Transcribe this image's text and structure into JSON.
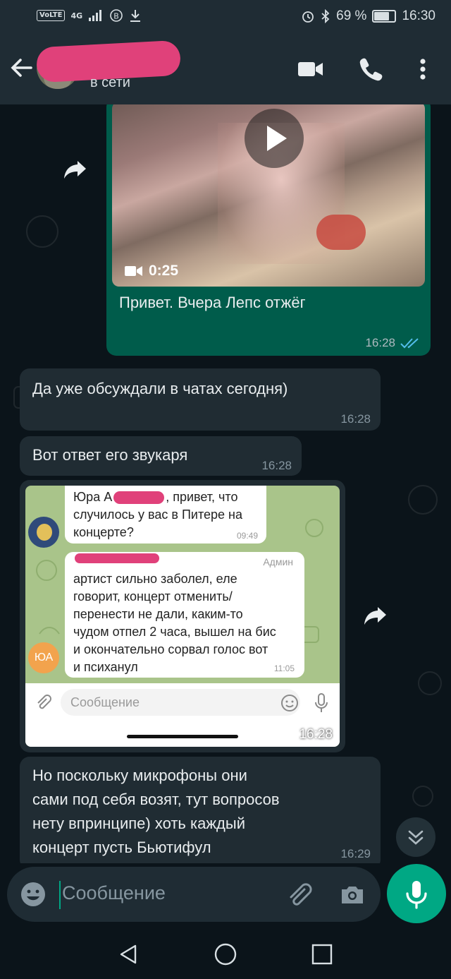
{
  "statusbar": {
    "volte": "VoLTE",
    "network": "4G",
    "battery": "69 %",
    "battery_level": 0.69,
    "time": "16:30"
  },
  "header": {
    "contact_status": "в сети"
  },
  "messages": {
    "video": {
      "duration": "0:25",
      "caption": "Привет. Вчера Лепс отжёг",
      "time": "16:28"
    },
    "m1": {
      "text": "Да уже обсуждали в чатах сегодня)",
      "time": "16:28"
    },
    "m2": {
      "text": "Вот ответ его звукаря",
      "time": "16:28"
    },
    "screenshot": {
      "q_line1": "Юра А",
      "q_line1b": ", привет, что",
      "q_line2": "случилось у вас в Питере на",
      "q_line3": "концерте?",
      "q_time": "09:49",
      "a_role": "Админ",
      "a_lines": [
        "артист сильно заболел, еле",
        "говорит, концерт отменить/",
        "перенести не дали, каким-то",
        "чудом отпел 2 часа, вышел на бис",
        "и окончательно сорвал голос вот",
        "и психанул"
      ],
      "a_time": "11:05",
      "a_avatar": "ЮА",
      "input_placeholder": "Сообщение",
      "time": "16:28"
    },
    "m3": {
      "lines": [
        "Но поскольку микрофоны они",
        "сами под себя возят, тут вопросов",
        "нету впринципе) хоть каждый",
        "концерт пусть Бьютифул"
      ],
      "time": "16:29"
    }
  },
  "composer": {
    "placeholder": "Сообщение"
  },
  "colors": {
    "accent": "#00a884",
    "outgoing_bubble": "#005c4b",
    "incoming_bubble": "#202c33",
    "read_ticks": "#53bdeb",
    "redaction": "#e0417a"
  },
  "icons": [
    "back-arrow-icon",
    "video-call-icon",
    "phone-icon",
    "more-vert-icon",
    "play-icon",
    "video-camera-icon",
    "double-check-icon",
    "forward-icon",
    "chevron-double-down-icon",
    "emoji-icon",
    "attach-icon",
    "camera-icon",
    "mic-icon",
    "nav-back-icon",
    "nav-home-icon",
    "nav-recents-icon"
  ]
}
